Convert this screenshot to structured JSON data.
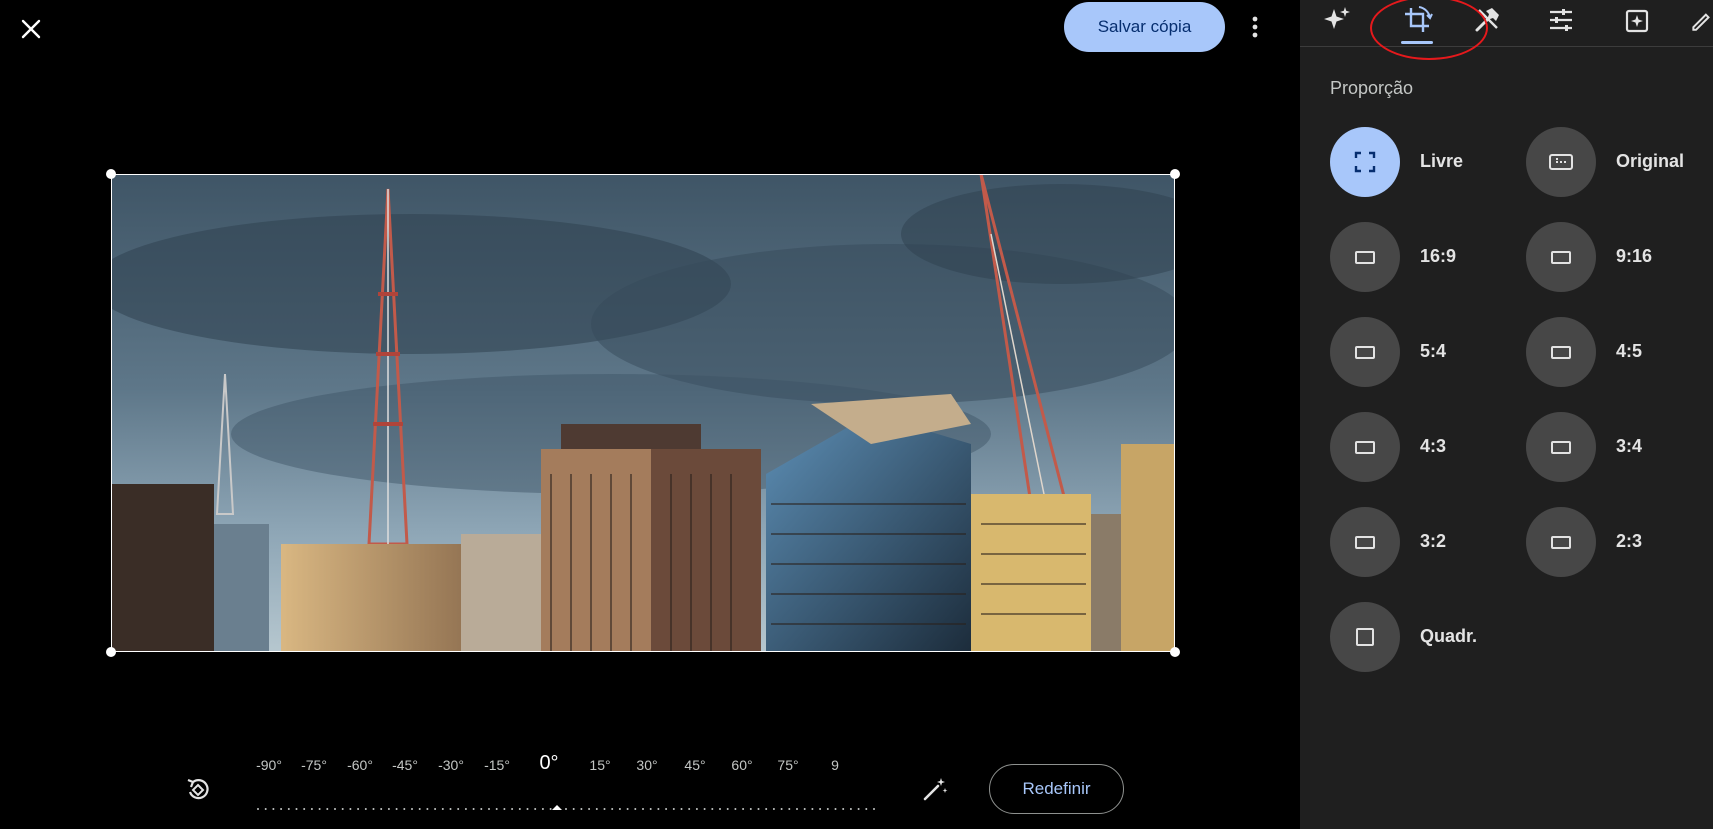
{
  "toolbar": {
    "save_label": "Salvar cópia",
    "close_icon": "close-icon",
    "more_icon": "more-vert-icon"
  },
  "rotation": {
    "labels": [
      "-90°",
      "-75°",
      "-60°",
      "-45°",
      "-30°",
      "-15°",
      "0°",
      "15°",
      "30°",
      "45°",
      "60°",
      "75°",
      "9"
    ],
    "current": "0°",
    "reset_label": "Redefinir"
  },
  "panel": {
    "tabs": [
      {
        "name": "suggestions",
        "icon": "sparkle-icon",
        "active": false
      },
      {
        "name": "crop",
        "icon": "crop-rotate-icon",
        "active": true
      },
      {
        "name": "tools",
        "icon": "tools-icon",
        "active": false
      },
      {
        "name": "adjust",
        "icon": "tune-icon",
        "active": false
      },
      {
        "name": "filters",
        "icon": "filter-add-icon",
        "active": false
      },
      {
        "name": "markup",
        "icon": "markup-icon",
        "active": false
      }
    ],
    "section_title": "Proporção",
    "options": [
      {
        "label": "Livre",
        "icon": "free-crop-icon",
        "selected": true
      },
      {
        "label": "Original",
        "icon": "original-ratio-icon",
        "selected": false
      },
      {
        "label": "16:9",
        "icon": "ratio-icon",
        "selected": false
      },
      {
        "label": "9:16",
        "icon": "ratio-icon",
        "selected": false
      },
      {
        "label": "5:4",
        "icon": "ratio-icon",
        "selected": false
      },
      {
        "label": "4:5",
        "icon": "ratio-icon",
        "selected": false
      },
      {
        "label": "4:3",
        "icon": "ratio-icon",
        "selected": false
      },
      {
        "label": "3:4",
        "icon": "ratio-icon",
        "selected": false
      },
      {
        "label": "3:2",
        "icon": "ratio-icon",
        "selected": false
      },
      {
        "label": "2:3",
        "icon": "ratio-icon",
        "selected": false
      },
      {
        "label": "Quadr.",
        "icon": "square-ratio-icon",
        "selected": false
      }
    ]
  },
  "colors": {
    "accent": "#a8c7fa",
    "panel_bg": "#1f1f1f",
    "option_bg": "#474747",
    "annotation": "#e5191c"
  }
}
